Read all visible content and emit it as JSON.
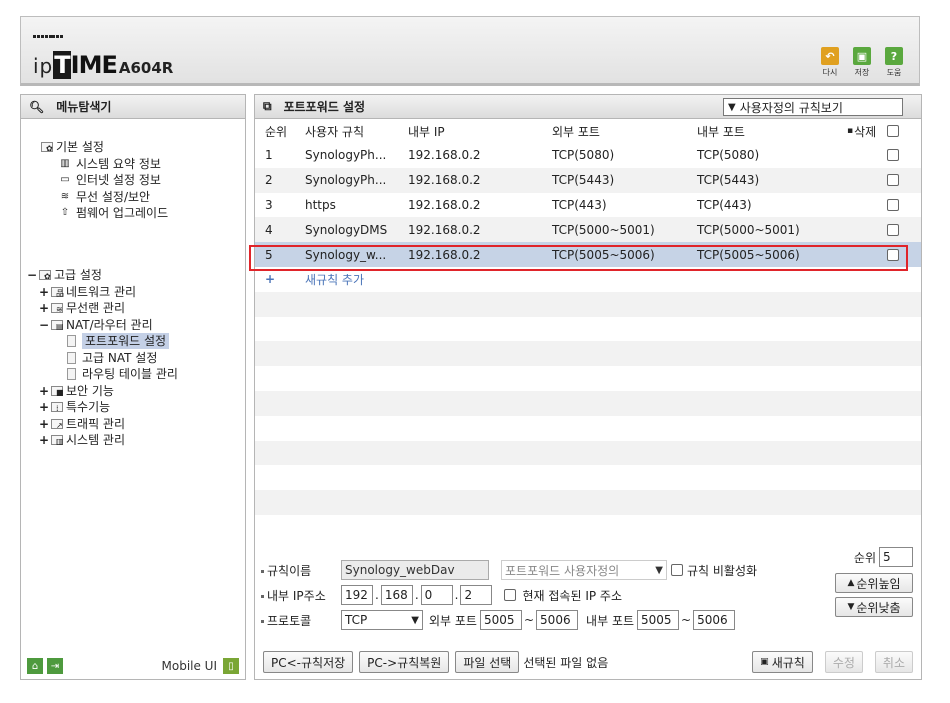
{
  "header": {
    "brand_ip": "ip",
    "brand_time_t": "T",
    "brand_time_rest": "IME",
    "model": "A604R",
    "tools": [
      {
        "label": "다시",
        "icon": "refresh-icon",
        "color": "#e0a020"
      },
      {
        "label": "저장",
        "icon": "save-icon",
        "color": "#5aa83e"
      },
      {
        "label": "도움",
        "icon": "help-icon",
        "color": "#5aa83e",
        "glyph": "?"
      }
    ]
  },
  "menu": {
    "title": "메뉴탐색기",
    "basic": {
      "label": "기본 설정",
      "items": [
        "시스템 요약 정보",
        "인터넷 설정 정보",
        "무선 설정/보안",
        "펌웨어 업그레이드"
      ]
    },
    "advanced": {
      "label": "고급 설정",
      "items": {
        "network": "네트워크 관리",
        "wireless": "무선랜 관리",
        "nat": "NAT/라우터 관리",
        "nat_children": [
          "포트포워드 설정",
          "고급 NAT 설정",
          "라우팅 테이블 관리"
        ],
        "security": "보안 기능",
        "special": "특수기능",
        "traffic": "트래픽 관리",
        "system": "시스템 관리"
      }
    },
    "mobile_ui": "Mobile UI"
  },
  "port_forward": {
    "title": "포트포워드 설정",
    "view_select": "사용자정의 규칙보기",
    "columns": {
      "rank": "순위",
      "name": "사용자 규칙",
      "ip": "내부 IP",
      "ext": "외부 포트",
      "int": "내부 포트",
      "del": "삭제"
    },
    "rows": [
      {
        "rank": "1",
        "name": "SynologyPh...",
        "ip": "192.168.0.2",
        "ext": "TCP(5080)",
        "int": "TCP(5080)"
      },
      {
        "rank": "2",
        "name": "SynologyPh...",
        "ip": "192.168.0.2",
        "ext": "TCP(5443)",
        "int": "TCP(5443)"
      },
      {
        "rank": "3",
        "name": "https",
        "ip": "192.168.0.2",
        "ext": "TCP(443)",
        "int": "TCP(443)"
      },
      {
        "rank": "4",
        "name": "SynologyDMS",
        "ip": "192.168.0.2",
        "ext": "TCP(5000~5001)",
        "int": "TCP(5000~5001)"
      },
      {
        "rank": "5",
        "name": "Synology_w...",
        "ip": "192.168.0.2",
        "ext": "TCP(5005~5006)",
        "int": "TCP(5005~5006)"
      }
    ],
    "add_rule": "새규칙 추가",
    "form": {
      "rule_name_label": "규칙이름",
      "rule_name_value": "Synology_webDav",
      "rule_type": "포트포워드 사용자정의",
      "disable_label": "규칙 비활성화",
      "ip_label": "내부 IP주소",
      "ip": [
        "192",
        "168",
        "0",
        "2"
      ],
      "current_ip_label": "현재 접속된 IP 주소",
      "protocol_label": "프로토콜",
      "protocol_value": "TCP",
      "ext_port_label": "외부 포트",
      "ext_port_from": "5005",
      "ext_port_to": "5006",
      "int_port_label": "내부 포트",
      "int_port_from": "5005",
      "int_port_to": "5006",
      "rank_label": "순위",
      "rank_value": "5",
      "rank_up": "순위높임",
      "rank_down": "순위낮춤"
    },
    "bottom": {
      "save_to_pc": "PC<-규칙저장",
      "restore_from_pc": "PC->규칙복원",
      "choose_file": "파일 선택",
      "no_file": "선택된 파일 없음",
      "new_rule": "새규칙",
      "modify": "수정",
      "cancel": "취소"
    }
  }
}
